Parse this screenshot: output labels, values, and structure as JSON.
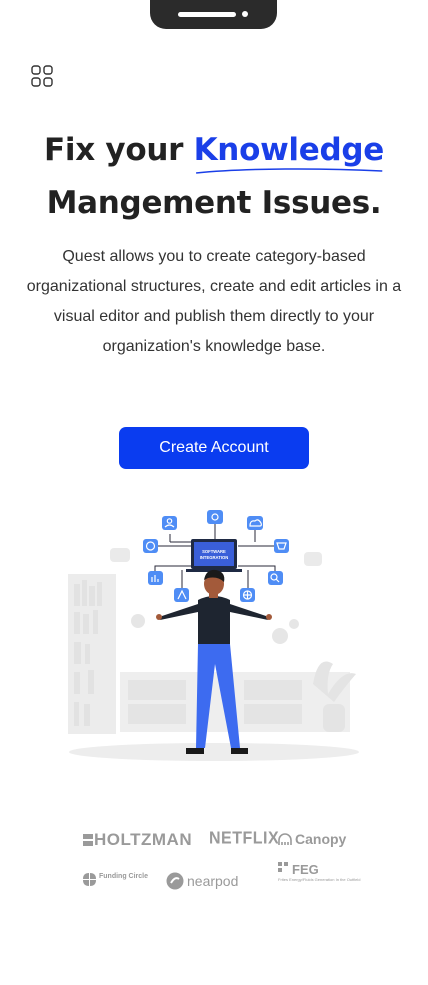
{
  "hero": {
    "title_prefix": "Fix your ",
    "title_accent": "Knowledge",
    "title_line2": "Mangement Issues.",
    "description": "Quest allows you to create category-based organizational structures, create and edit articles in a visual editor and publish them directly to your organization's knowledge base.",
    "cta_label": "Create Account",
    "accent_color": "#1a3fe8",
    "cta_color": "#0a3cf0"
  },
  "illustration": {
    "screen_label": "SOFTWARE INTEGRATION"
  },
  "logos": {
    "holtzman": "HOLTZMAN",
    "netflix": "NETFLIX",
    "canopy": "Canopy",
    "funding_circle": "Funding Circle",
    "nearpod": "nearpod",
    "feg": "FEG",
    "feg_sub": "Frites Energy/Fluids Generation In the Outfield"
  }
}
